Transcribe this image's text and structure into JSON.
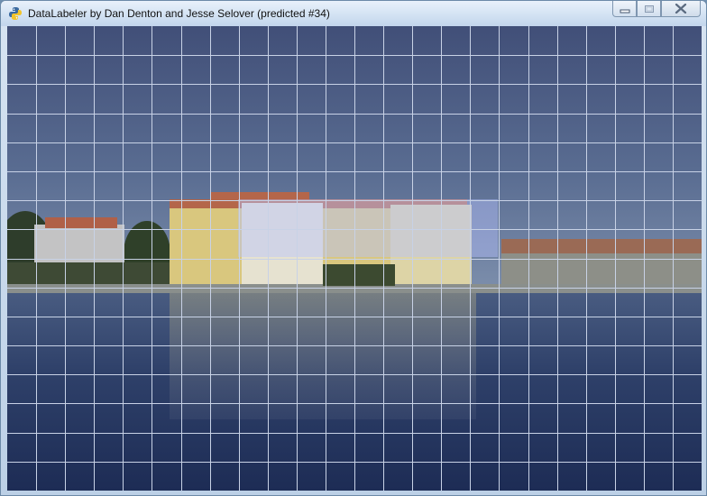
{
  "window": {
    "title": "DataLabeler by Dan Denton and Jesse Selover (predicted #34)",
    "app_icon": "python-icon",
    "controls": [
      "minimize-icon",
      "maximize-icon",
      "close-icon"
    ]
  },
  "canvas": {
    "grid": {
      "columns": 24,
      "rows": 16,
      "line_color": "#c8d2e6"
    },
    "highlight": {
      "columns": [
        8,
        16
      ],
      "rows": [
        6,
        8
      ],
      "color": "#b9c3ff"
    }
  }
}
